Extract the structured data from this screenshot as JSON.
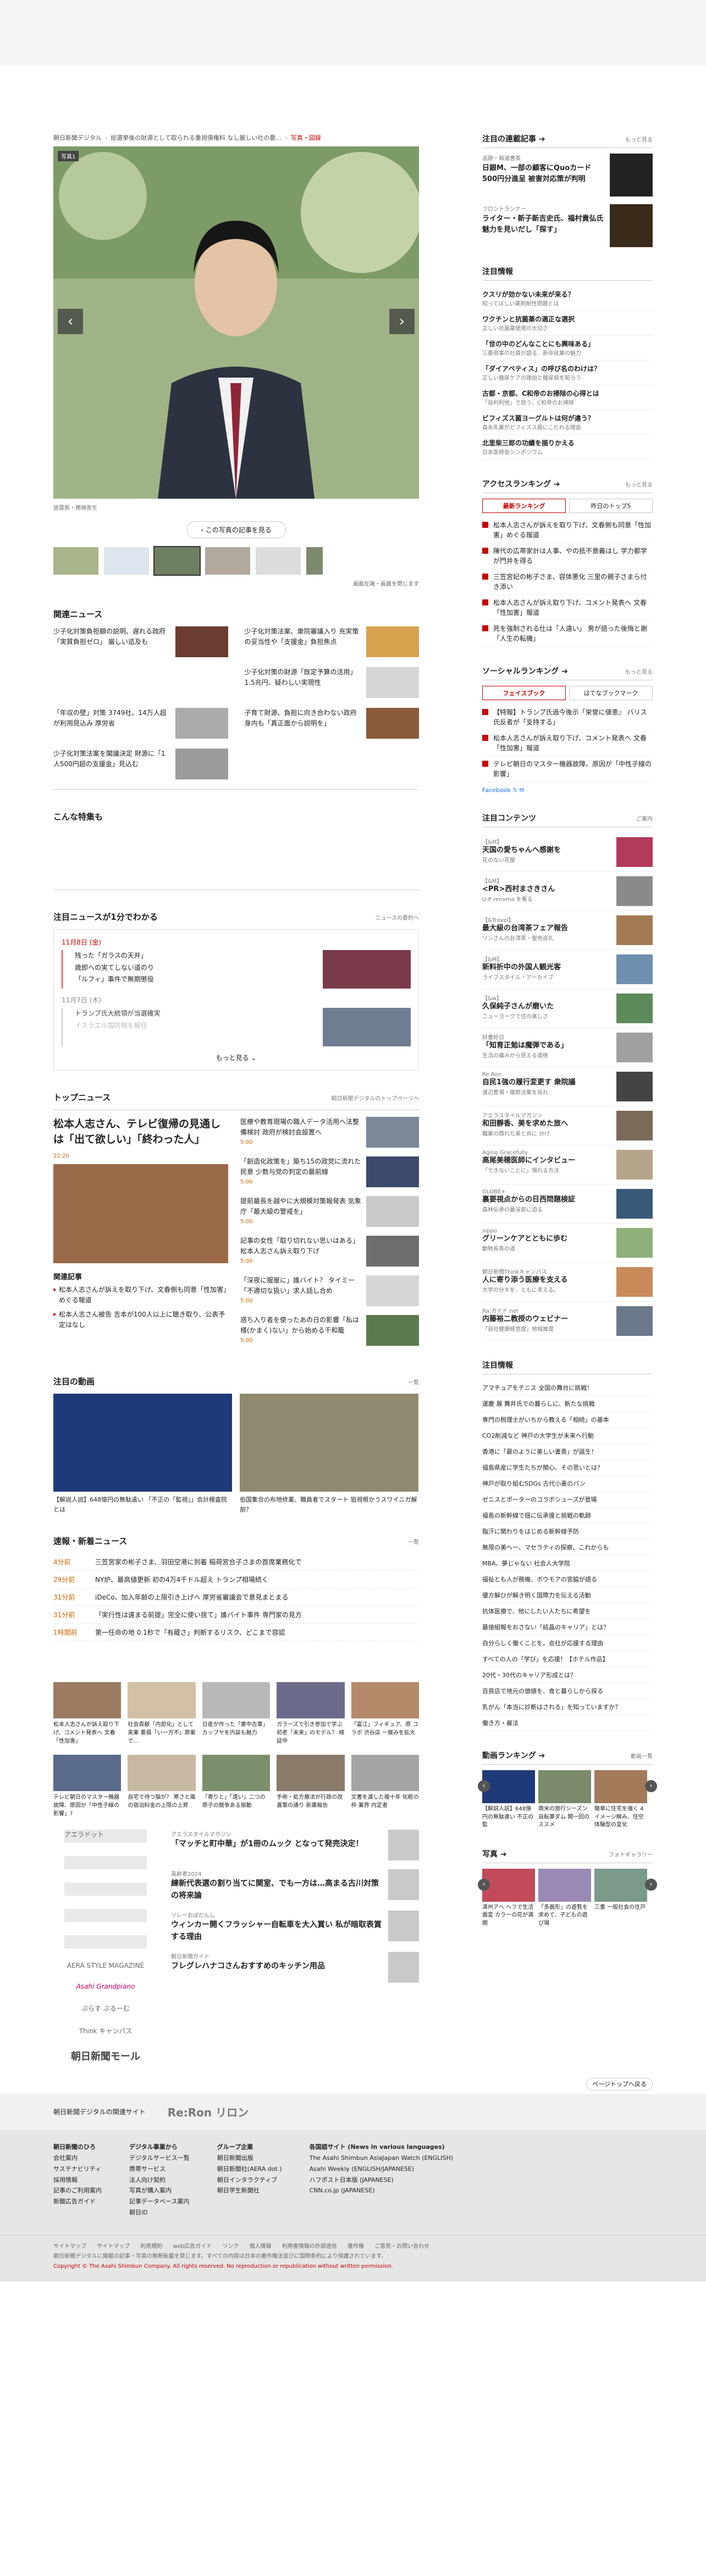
{
  "breadcrumb": [
    "朝日新聞デジタル",
    "総選挙後の財源として取られる重視債権料 なし厳しい社の要…",
    "写真・図録"
  ],
  "hero": {
    "badge": "写真1",
    "caption": "披露那・穂積香生"
  },
  "back_label": "‹ この写真の記事を見る",
  "next_image_label": "画面左端・画面を閉じます",
  "related": {
    "title": "関連ニュース",
    "items": [
      "少子化対策負担額の説明、遅れる政府「実質負担ゼロ」 厳しい追及も",
      "少子化対策法案、衆院審議入り 充実策の妥当性や「支援金」負担焦点",
      "",
      "少子化対策の財源「既定予算の活用」1.5兆円、疑わしい実現性",
      "「年収の壁」対策 3749社、14万人超が利用見込み 厚労省",
      "子育て財源、負担に向き合わない政府 身内も「真正面から説明を」",
      "少子化対策法案を閣議決定 財源に「1人500円超の支援金」見込む",
      ""
    ]
  },
  "special": {
    "title": "こんな特集も"
  },
  "digest": {
    "title": "注目ニュースが1分でわかる",
    "more": "ニュースの要約へ",
    "days": [
      {
        "date": "11月8日 (金)",
        "items": [
          "残った「ガラスの天井」",
          "歳即への実てしない道のり",
          "「ルフィ」事件で無期懲役"
        ]
      },
      {
        "date": "11月7日 (木)",
        "items": [
          "トランプ氏大統領が当選確実",
          "イスラエル国防相を解任"
        ]
      }
    ],
    "more_label": "もっと見る ⌄"
  },
  "top": {
    "title": "トップニュース",
    "more": "朝日新聞デジタルのトップページへ",
    "headline": "松本人志さん、テレビ復帰の見通しは「出て欲しい」「終わった人」",
    "headline_time": "22:20",
    "related_title": "関連記事",
    "related": [
      "松本人志さんが訴えを取り下げ、文春側も同意「性加害」めぐる報道",
      "松本人志さん被告 吉本が100人以上に聴き取り、公表予定はなし"
    ],
    "right": [
      {
        "t": "医療や教育現場の職人データ活用へ法整備検討 政府が検討会設置へ",
        "tm": "5:00"
      },
      {
        "t": "「創造化政策を」築ち15の政党に流れた民意 少数与党の判定の最前線",
        "tm": "5:00"
      },
      {
        "t": "提前最長を越やに大規模対策報発表 気象庁「最大級の警戒を」",
        "tm": "5:00"
      },
      {
        "t": "記事の女性「取り切れない思いはある」 松本人志さん訴え取り下げ",
        "tm": "5:00"
      },
      {
        "t": "「深夜に服屋に」誰バイト？ タイミー「不適切な扱い」求人話し合め",
        "tm": "5:00"
      },
      {
        "t": "惑ち入り者を使ったあの日の影響「私は様(かまく)ない」から始める千和籠",
        "tm": "5:00"
      }
    ]
  },
  "videos": {
    "title": "注目の動画",
    "more": "一覧",
    "items": [
      "【解説人説】648億円の無駄遣い 「不正の「監視」」会計検査院とは",
      "伯国集合の布地修業、職員者でスタート 狙視根かうスワイニガ解剖？"
    ]
  },
  "flash": {
    "title": "速報・新着ニュース",
    "more": "一覧",
    "items": [
      {
        "tm": "4分前",
        "t": "三笠宮家の彬子さま、羽田空港に到着 稲荷宮合子さまの首席業務化で"
      },
      {
        "tm": "29分前",
        "t": "NY炉、最高値更新 初の4万4千ドル超え トランプ相場続く"
      },
      {
        "tm": "31分前",
        "t": "iDeCo、加入年齢の上限引き上げへ 厚労省審議会で意見まとまる"
      },
      {
        "tm": "31分前",
        "t": "「実行性は遠まる前提」完全に使い捨て」誰バイト事件 専門家の見方"
      },
      {
        "tm": "1時間前",
        "t": "第一任命の地 0.1秒で「有蔵さ」判断するリスク、どこまで容認"
      }
    ]
  },
  "grid": [
    "松本人志さんが訴え取り下げ、コメント発表へ 文春「性加害」",
    "社会貢献「内部化」として実業 要員「い一方不」原案で…",
    "日産が作った「妻中古車」カップヤを内装も魅力",
    "ガラーズで引き参加で学ぶ 初老「未来」のモデル？ 検証中",
    "「富江」フィギュア、原 コラボ 渋谷店 一展みを拡大",
    "テレビ朝日のマスター機器故障、原因が「中性子線の影響」?",
    "自宅で待つ猫が？ 寒さと風の宿泊料金の上限の上昇",
    "「寄りと」「遠い」二つの原子の競争ある振動",
    "手術・処方療法が行政の改善策の通り 新薬報告",
    "文書を渡した複十年 化粧の枠 業界 内定者"
  ],
  "brands": {
    "logos": [
      "アエラドット",
      "AERA STYLE MAGAZINE",
      "Asahi Grandpiano",
      "ぷらす ぶるーむ",
      "Think キャンパス"
    ],
    "aera_style": "AERA STYLE MAGAZINE",
    "think": "Think キャンパス",
    "mall": "朝日新聞モール",
    "articles": [
      {
        "src": "アエラスタイルマガジン",
        "t": "「マッチと町中華」が1冊のムック となって発売決定！"
      },
      {
        "src": "高齢者2024",
        "t": "練新代表選の割り当てに関室、でも一方は…高まる古川対策の将来論"
      },
      {
        "src": "リレーおぼだんし",
        "t": "ウィンカー開くフラッシャー自転車を大入賞い 私が暗取表賞する理由"
      },
      {
        "src": "朝日新聞ガイド",
        "t": "フレグレハナコさんおすすめのキッチン用品"
      }
    ]
  },
  "side": {
    "series_title": "注目の連載記事 ➔",
    "series_more": "もっと見る",
    "series": [
      {
        "src": "追跡・報道書斎",
        "t": "日銀M、一部の顧客にQuoカード500円分進呈 被害対応策が判明"
      },
      {
        "src": "フロントランナー",
        "t": "ライター・新子新吉史氏、福村貴弘氏 魅力を見いだし「探す」"
      }
    ],
    "ad_title": "注目情報",
    "ads": [
      {
        "t": "クスリが効かない未来が来る？",
        "s": "知ってほしい薬剤耐性問題とは"
      },
      {
        "t": "ワクチンと抗菌薬の適正な選択",
        "s": "正しい抗菌薬使用の大切さ"
      },
      {
        "t": "「世の中のどんなことにも興味ある」",
        "s": "三菱商事の社員が語る、新卒就業の魅力"
      },
      {
        "t": "「ダイアベティス」の呼び名のわけは？",
        "s": "正しい糖尿ケアの理由と糖尿病を知ろう"
      },
      {
        "t": "古都・京都、C和帝のお掃除の心得とは",
        "s": "「自利利他」で拾う、C和帝のお掃除"
      },
      {
        "t": "ビフィズス菌ヨーグルトは何が違う？",
        "s": "森永乳業がビフィズス菌にこだわる理由"
      },
      {
        "t": "北里柴三郎の功績を振りかえる",
        "s": "日本医師会シンポジウム"
      }
    ],
    "rank_title": "アクセスランキング ➔",
    "rank_more": "もっと見る",
    "rank_tabs": [
      "最新ランキング",
      "昨日のトップ5"
    ],
    "ranks": [
      "松本人志さんが訴えを取り下げ、文春側も同意「性加害」めぐる報道",
      "陳代の広帯家計は人事、やの抵不意義はし 学力都学が門井を得る",
      "三笠宮妃の彬子さま、容体悪化 三里の親子さまら付き添い",
      "松本人志さんが訴え取り下げ、コメント発表へ 文春「性加害」報道",
      "死を強制される仕は「人遠い」 男が語った後悔と謝「人生の転機」"
    ],
    "social_title": "ソーシャルランキング ➔",
    "social_more": "もっと見る",
    "social_tabs": [
      "フェイスブック",
      "はてなブックマーク"
    ],
    "socials": [
      "【特報】トランプ氏過今後示「栄誉に値恵』 バリス氏反者が「支持する」",
      "松本人志さんが訴え取り下げ、コメント発表へ 文春「性加害」報道",
      "テレビ朝日のマスター機器故障、原因が「中性子線の影響」",
      "「Facebook」"
    ],
    "follow_label": "Facebook  𝕏  ✉",
    "content_title": "注目コンテンツ",
    "content_more": "ご案内",
    "contents": [
      {
        "s": "【&M】",
        "t": "天国の愛ちゃんへ感謝を",
        "d": "花のない花屋"
      },
      {
        "s": "【&M】",
        "t": "<PR>西村まさきさん",
        "d": "U-P renoma を着る"
      },
      {
        "s": "【&Travel】",
        "t": "最大級の台湾茶フェア報告",
        "d": "リンさんの台湾茶・聖地巡礼"
      },
      {
        "s": "【&M】",
        "t": "新料折中の外国人観光客",
        "d": "ライフスタイル・アーカイブ"
      },
      {
        "s": "【&w】",
        "t": "久保純子さんが磨いた",
        "d": "ニューヨークで住の楽しさ"
      },
      {
        "s": "好書好日",
        "t": "「知育正勉は魔弾である」",
        "d": "生活の痛みから見える道徳"
      },
      {
        "s": "Re:Ron",
        "t": "自民1強の履行変更す 衆院議",
        "d": "渡辺豊場・雄郎法案を巡れ"
      },
      {
        "s": "アエラスタイルマガジン",
        "t": "和田靜香、美を求めた旅へ",
        "d": "職業の隠れた美と共に 分け"
      },
      {
        "s": "Aging Gracefully",
        "t": "高尾美穂医師にインタビュー",
        "d": "「できないことに」慣れる方法"
      },
      {
        "s": "GLOBE+",
        "t": "裏要視点からの日西問題検証",
        "d": "森林伝承の最深部に迫る"
      },
      {
        "s": "sippo",
        "t": "グリーンケアとともに歩む",
        "d": "動物長寿の道"
      },
      {
        "s": "朝日新聞Thinkキャンパス",
        "t": "人に寄り添う医療を支える",
        "d": "大学の分キを、ともに考える。"
      },
      {
        "s": "Ra:ガイド.net",
        "t": "内藤裕二教授のウェビナー",
        "d": "「自社健康経営度」地域推奨"
      }
    ],
    "pr_title": "注目情報",
    "prs": [
      "アマチュアをテニス 全国の舞台に挑戦！",
      "運慶 展 舞井氏での暮らしに、新たな挑戦",
      "専門の税理士がいちから教える「相続」の基本",
      "CO2削減など 神戸の大学生が未来へ行動",
      "香港に「最のように美しい書斎」が誕生！",
      "福島県産に学生たちが関心、その思いとは？",
      "神戸が取り組むSDGs 古代小麦のパン",
      "ゼニスとポーターのコラボシューズが登場",
      "福島の新幹線で揺に伝承援と挑戦の軌跡",
      "脂汗に関わりをはじめる新幹線予防",
      "無限の美へ一、マセラティの探察、これからも",
      "MBA、夢じゃない 社会人大学院",
      "福祉とも人が務機、ボウモアの宮脇が語る",
      "優方解ひが解き明く国際力を伝える活動",
      "抗体医療で、他にしたい人たちに希望を",
      "最接組報をおさない「結晶のキャリア」とは？",
      "自分らしく働くことを。会社が応援する理由",
      "すべての人の「学び」を応援！【ホテル作品】",
      "20代・30代のキャリア形成とは？",
      "百貨店で地元の価値を、食と暮らしから探る",
      "乳がん「本当に診断はされる」を知っていますか？",
      "働き方・雇法"
    ],
    "video_rank_title": "動画ランキング ➔",
    "video_rank_more": "動画一覧",
    "video_ranks": [
      "【解説人説】648億円の無駄遣い 不正の監",
      "南米の旅行シーズン 自転車ダム 開一回のススメ",
      "簡単に住宅を強く 4イメージ瞬み、住空体験型の変化"
    ],
    "photo_title": "写真 ➔",
    "photo_more": "フォトギャラリー",
    "photos": [
      "清州アへ ヘフで生活面変 カラーの花が満開",
      "「多面形」の遊覧を求めて、子どもの遊び場",
      "三重 一般社会の住戸"
    ]
  },
  "pagetop": "ページトップへ戻る",
  "footer": {
    "recommend": "朝日新聞デジタルの関連サイト",
    "reron": "Re:Ron リロン",
    "cols": [
      {
        "h": "朝日新聞のひろ",
        "items": [
          "会社案内",
          "サステナビリティ",
          "採用情報",
          "記事のご利用案内",
          "新聞広告ガイド"
        ]
      },
      {
        "h": "デジタル事業から",
        "items": [
          "デジタルサービス一覧",
          "携帯サービス",
          "法人向け契約",
          "写真が購入案内",
          "記事データベース案内",
          "朝日iD"
        ]
      },
      {
        "h": "グループ企業",
        "items": [
          "朝日新聞出版",
          "朝日新聞社(AERA dot.)",
          "朝日インタラクティブ",
          "朝日学生新聞社"
        ]
      },
      {
        "h": "各国語サイト (News in various languages)",
        "items": [
          "The Asahi Shimbun AsiaJapan Watch (ENGLISH)",
          "Asahi Weekly (ENGLISH/JAPANESE)",
          "ハフポスト日本版 (JAPANESE)",
          "CNN.co.jp (JAPANESE)"
        ]
      }
    ],
    "links": [
      "サイトマップ",
      "サイトマップ",
      "利用規約",
      "web広告ガイド",
      "リンク",
      "個人情報",
      "利用者情報の外部送信",
      "著作権",
      "ご意見・お問い合わせ"
    ],
    "notice": "朝日新聞デジタルに掲載の記事・写真の無断転載を禁じます。すべての内容は日本の著作権法並びに国際条約により保護されています。",
    "copyright": "Copyright © The Asahi Shimbun Company. All rights reserved. No reproduction or republication without written permission."
  },
  "colors": {
    "accent": "#cc0000",
    "time": "#cc6600"
  }
}
